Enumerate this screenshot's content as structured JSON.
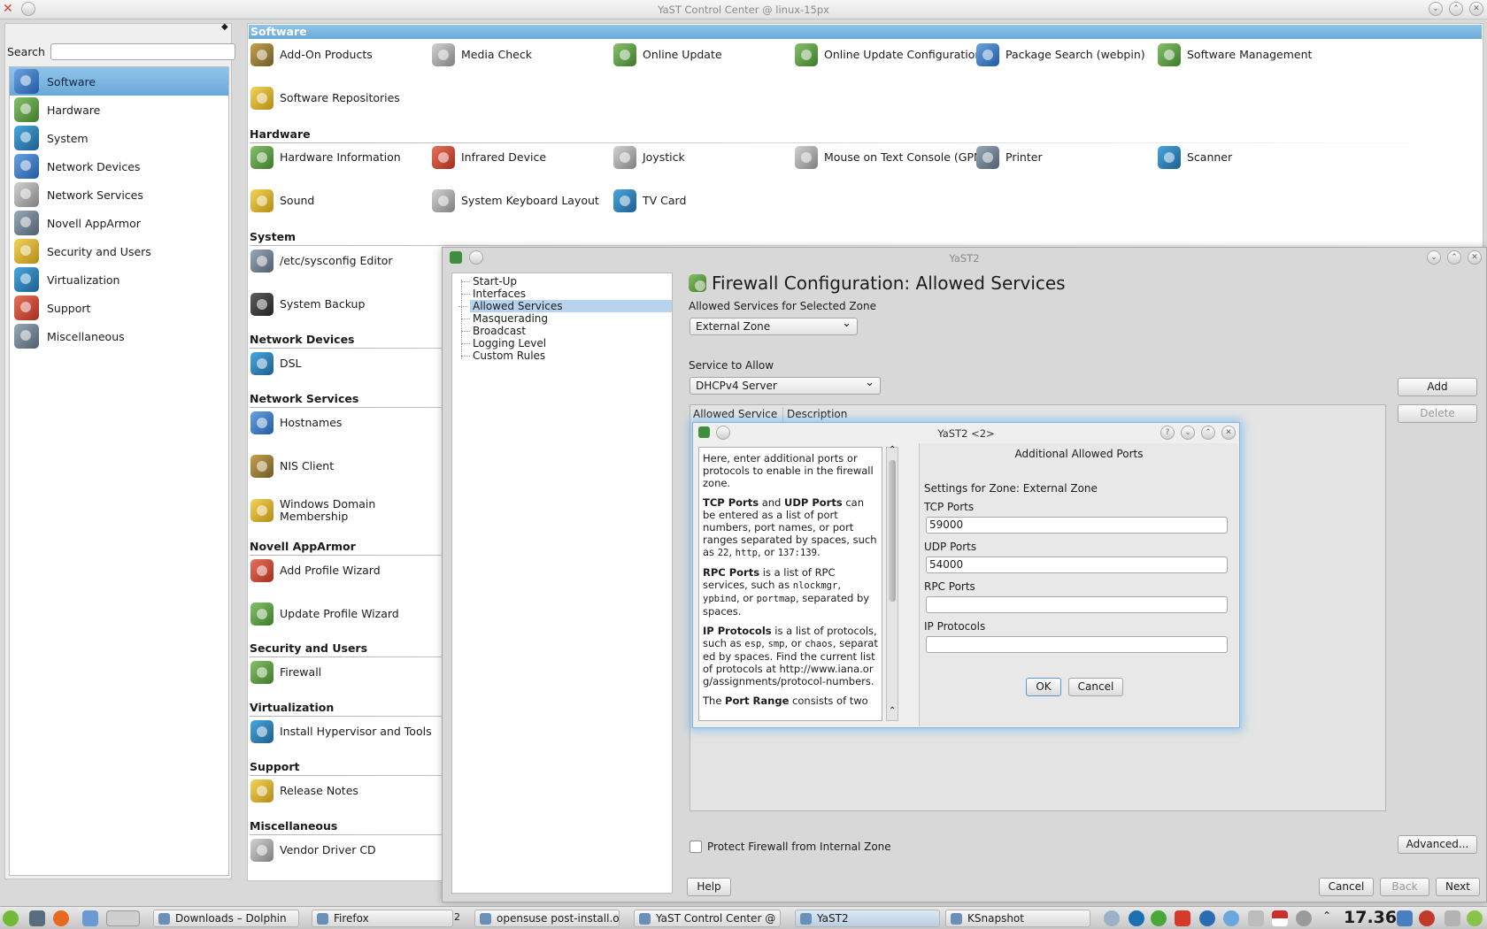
{
  "window": {
    "title": "YaST Control Center @ linux-15px"
  },
  "search": {
    "label": "Search",
    "value": ""
  },
  "sidebar": {
    "items": [
      {
        "label": "Software",
        "icon": "software-icon"
      },
      {
        "label": "Hardware",
        "icon": "hardware-icon"
      },
      {
        "label": "System",
        "icon": "system-icon"
      },
      {
        "label": "Network Devices",
        "icon": "network-devices-icon"
      },
      {
        "label": "Network Services",
        "icon": "network-services-icon"
      },
      {
        "label": "Novell AppArmor",
        "icon": "apparmor-icon"
      },
      {
        "label": "Security and Users",
        "icon": "security-icon"
      },
      {
        "label": "Virtualization",
        "icon": "virtualization-icon"
      },
      {
        "label": "Support",
        "icon": "support-icon"
      },
      {
        "label": "Miscellaneous",
        "icon": "miscellaneous-icon"
      }
    ]
  },
  "groups": {
    "software": {
      "title": "Software",
      "items": [
        "Add-On Products",
        "Media Check",
        "Online Update",
        "Online Update Configuration",
        "Package Search (webpin)",
        "Software Management",
        "Software Repositories"
      ]
    },
    "hardware": {
      "title": "Hardware",
      "items": [
        "Hardware Information",
        "Infrared Device",
        "Joystick",
        "Mouse on Text Console (GPM)",
        "Printer",
        "Scanner",
        "Sound",
        "System Keyboard Layout",
        "TV Card"
      ]
    },
    "system": {
      "title": "System",
      "items": [
        "/etc/sysconfig Editor",
        "System Backup"
      ]
    },
    "network_devices": {
      "title": "Network Devices",
      "items": [
        "DSL"
      ]
    },
    "network_services": {
      "title": "Network Services",
      "items": [
        "Hostnames",
        "NIS Client",
        "Windows Domain",
        "Membership"
      ]
    },
    "apparmor": {
      "title": "Novell AppArmor",
      "items": [
        "Add Profile Wizard",
        "Update Profile Wizard"
      ]
    },
    "security": {
      "title": "Security and Users",
      "items": [
        "Firewall"
      ]
    },
    "virtualization": {
      "title": "Virtualization",
      "items": [
        "Install Hypervisor and Tools"
      ]
    },
    "support": {
      "title": "Support",
      "items": [
        "Release Notes"
      ]
    },
    "misc": {
      "title": "Miscellaneous",
      "items": [
        "Vendor Driver CD"
      ]
    }
  },
  "firewall": {
    "window_title": "YaST2",
    "tree": [
      "Start-Up",
      "Interfaces",
      "Allowed Services",
      "Masquerading",
      "Broadcast",
      "Logging Level",
      "Custom Rules"
    ],
    "heading": "Firewall Configuration: Allowed Services",
    "zone_label": "Allowed Services for Selected Zone",
    "zone_value": "External Zone",
    "service_label": "Service to Allow",
    "service_value": "DHCPv4 Server",
    "add": "Add",
    "delete": "Delete",
    "col_service": "Allowed Service",
    "col_description": "Description",
    "protect_label": "Protect Firewall from Internal Zone",
    "advanced": "Advanced...",
    "help": "Help",
    "cancel": "Cancel",
    "back": "Back",
    "next": "Next"
  },
  "dialog": {
    "title": "YaST2 <2>",
    "heading": "Additional Allowed Ports",
    "zone_settings": "Settings for Zone: External Zone",
    "tcp_label": "TCP Ports",
    "tcp_value": "59000",
    "udp_label": "UDP Ports",
    "udp_value": "54000",
    "rpc_label": "RPC Ports",
    "rpc_value": "",
    "ip_label": "IP Protocols",
    "ip_value": "",
    "ok": "OK",
    "cancel": "Cancel",
    "help": {
      "p1": "Here, enter additional ports or protocols to enable in the firewall zone.",
      "p2_b1": "TCP Ports",
      "p2_and": " and ",
      "p2_b2": "UDP Ports",
      "p2_rest": " can be entered as a list of port numbers, port names, or port ranges separated by spaces, such as ",
      "p2_c1": "22",
      "p2_c2": "http",
      "p2_or": ", or ",
      "p2_c3": "137:139",
      "p3_b": "RPC Ports",
      "p3_rest": " is a list of RPC services, such as ",
      "p3_c1": "nlockmgr",
      "p3_c2": "ypbind",
      "p3_c3": "portmap",
      "p3_end": ", separated by spaces.",
      "p4_b": "IP Protocols",
      "p4_rest": " is a list of protocols, such as ",
      "p4_c1": "esp",
      "p4_c2": "smp",
      "p4_c3": "chaos",
      "p4_end": ", separated by spaces. Find the current list of protocols at http://www.iana.org/assignments/protocol-numbers.",
      "p5_a": "The ",
      "p5_b": "Port Range",
      "p5_c": " consists of two"
    }
  },
  "taskbar": {
    "tasks": [
      "Downloads – Dolphin",
      "Firefox",
      "opensuse post-install.odt -",
      "YaST Control Center @ linu",
      "YaST2",
      "KSnapshot"
    ],
    "desktop_num": "2",
    "clock": "17.36"
  }
}
